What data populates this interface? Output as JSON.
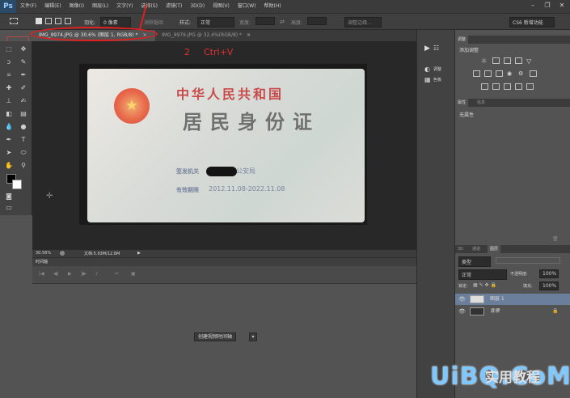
{
  "app": {
    "logo": "Ps",
    "workspace": "CS6 新增功能"
  },
  "menu": [
    "文件(F)",
    "编辑(E)",
    "图像(I)",
    "图层(L)",
    "文字(Y)",
    "选择(S)",
    "滤镜(T)",
    "3D(D)",
    "视图(V)",
    "窗口(W)",
    "帮助(H)"
  ],
  "options": {
    "feather_label": "羽化:",
    "feather_value": "0 像素",
    "antialias": "消除锯齿",
    "style_label": "样式:",
    "style_value": "正常",
    "width_label": "宽度:",
    "height_label": "高度:",
    "refine_edge": "调整边缘..."
  },
  "tabs": [
    {
      "label": "IMG_9974.JPG @ 30.6% (图层 1, RGB/8) *",
      "close": "×"
    },
    {
      "label": "IMG_9979.JPG @ 32.4%(RGB/8) *",
      "close": "×"
    }
  ],
  "card": {
    "title1": "中华人民共和国",
    "title2": "居民身份证",
    "authority_label": "签发机关",
    "authority_value": "公安局",
    "validity_label": "有效期限",
    "validity_value": "2012.11.08-2022.11.08"
  },
  "annotations": {
    "step": "2",
    "shortcut": "Ctrl+V"
  },
  "status": {
    "zoom": "30.56%",
    "doc": "文档:5.93M/12.8M"
  },
  "timeline": {
    "title": "时间轴",
    "create_button": "创建视频时间轴"
  },
  "dock": {
    "adjustments": "调整",
    "styles": "色板"
  },
  "panels": {
    "adjust_tab": "调整",
    "adjust_header": "添加调整",
    "props_tab": "属性",
    "props_tab2": "信息",
    "props_value": "无属性",
    "layers_tabs": [
      "3D",
      "通道",
      "图层"
    ],
    "kind_label": "类型",
    "blend_mode": "正常",
    "opacity_label": "不透明度:",
    "opacity_value": "100%",
    "lock_label": "锁定:",
    "fill_label": "填充:",
    "fill_value": "100%",
    "layers": [
      {
        "name": "图层 1",
        "selected": true
      },
      {
        "name": "背景",
        "selected": false
      }
    ]
  },
  "watermark": {
    "brand": "UiBQ.CoM",
    "cn": "实用教程"
  },
  "colors": {
    "accent_red": "#e02020",
    "selected_layer": "#6b7f9c"
  }
}
